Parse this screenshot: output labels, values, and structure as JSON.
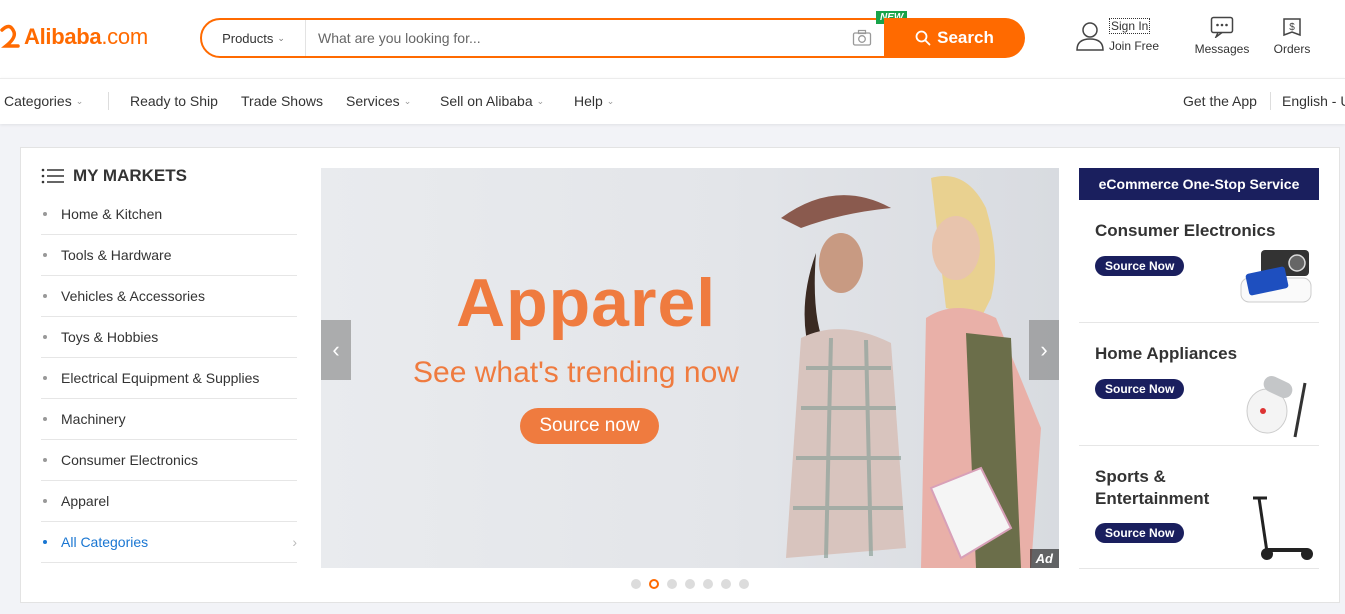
{
  "header": {
    "logo_text": "Alibaba",
    "logo_suffix": ".com",
    "search": {
      "category_label": "Products",
      "placeholder": "What are you looking for...",
      "new_badge": "NEW",
      "button_label": "Search"
    },
    "sign_in": "Sign In",
    "join_free": "Join Free",
    "messages": "Messages",
    "orders": "Orders"
  },
  "nav": {
    "categories": "Categories",
    "ready_to_ship": "Ready to Ship",
    "trade_shows": "Trade Shows",
    "services": "Services",
    "sell": "Sell on Alibaba",
    "help": "Help",
    "get_app": "Get the App",
    "language": "English - U"
  },
  "markets": {
    "title": "MY MARKETS",
    "items": [
      {
        "label": "Home & Kitchen"
      },
      {
        "label": "Tools & Hardware"
      },
      {
        "label": "Vehicles & Accessories"
      },
      {
        "label": "Toys & Hobbies"
      },
      {
        "label": "Electrical Equipment & Supplies"
      },
      {
        "label": "Machinery"
      },
      {
        "label": "Consumer Electronics"
      },
      {
        "label": "Apparel"
      }
    ],
    "all_label": "All Categories"
  },
  "banner": {
    "title": "Apparel",
    "subtitle": "See what's trending now",
    "button": "Source now",
    "ad": "Ad",
    "slide_count": 7,
    "active_slide": 2
  },
  "service": {
    "heading": "eCommerce One-Stop Service",
    "cards": [
      {
        "title": "Consumer Electronics",
        "button": "Source Now"
      },
      {
        "title": "Home Appliances",
        "button": "Source Now"
      },
      {
        "title": "Sports & Entertainment",
        "button": "Source Now"
      }
    ]
  },
  "colors": {
    "brand_orange": "#ff6a00",
    "banner_orange": "#ef7b3f",
    "navy": "#1a1f5e",
    "link_blue": "#1976d2"
  }
}
